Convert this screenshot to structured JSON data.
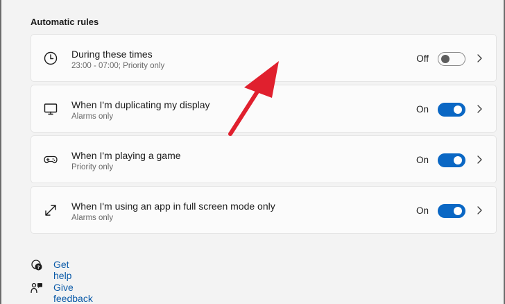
{
  "section_title": "Automatic rules",
  "rules": [
    {
      "icon": "clock-icon",
      "title": "During these times",
      "subtitle": "23:00 - 07:00; Priority only",
      "state": "Off",
      "enabled": false
    },
    {
      "icon": "monitor-icon",
      "title": "When I'm duplicating my display",
      "subtitle": "Alarms only",
      "state": "On",
      "enabled": true
    },
    {
      "icon": "gamepad-icon",
      "title": "When I'm playing a game",
      "subtitle": "Priority only",
      "state": "On",
      "enabled": true
    },
    {
      "icon": "fullscreen-icon",
      "title": "When I'm using an app in full screen mode only",
      "subtitle": "Alarms only",
      "state": "On",
      "enabled": true
    }
  ],
  "links": {
    "help": "Get help",
    "feedback": "Give feedback"
  },
  "colors": {
    "accent": "#0a67c4",
    "link": "#0a5aa8",
    "annotation_arrow": "#e0202e"
  }
}
